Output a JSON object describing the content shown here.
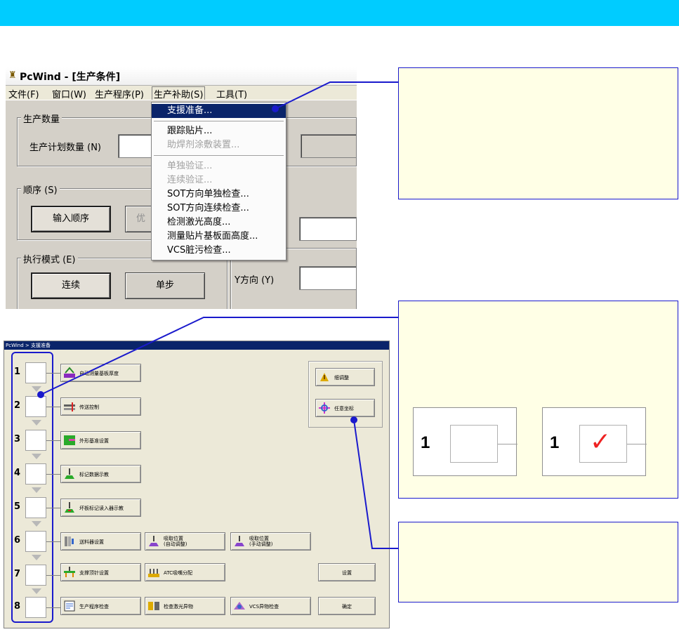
{
  "top_window": {
    "title": "PcWind - [生产条件]",
    "menubar": [
      "文件(F)",
      "窗口(W)",
      "生产程序(P)",
      "生产补助(S)",
      "工具(T)"
    ],
    "groups": {
      "quantity": {
        "label": "生产数量",
        "field_label": "生产计划数量 (N)"
      },
      "order": {
        "label": "顺序 (S)",
        "input_order_button": "输入顺序",
        "partial_button": "优"
      },
      "mode": {
        "label": "执行模式 (E)",
        "continuous_button": "连续",
        "single_step_button": "单步"
      },
      "y_direction_label": "Y方向 (Y)"
    },
    "dropdown": [
      {
        "label": "支援准备...",
        "state": "selected"
      },
      {
        "label": "跟踪贴片...",
        "state": "normal"
      },
      {
        "label": "助焊剂涂敷装置...",
        "state": "disabled"
      },
      {
        "label": "单独验证...",
        "state": "disabled"
      },
      {
        "label": "连续验证...",
        "state": "disabled"
      },
      {
        "label": "SOT方向单独检查...",
        "state": "normal"
      },
      {
        "label": "SOT方向连续检查...",
        "state": "normal"
      },
      {
        "label": "检测激光高度...",
        "state": "normal"
      },
      {
        "label": "测量贴片基板面高度...",
        "state": "normal"
      },
      {
        "label": "VCS脏污检查...",
        "state": "normal"
      }
    ]
  },
  "bottom_window": {
    "title": "PcWind > 支援准备",
    "steps": [
      "1",
      "2",
      "3",
      "4",
      "5",
      "6",
      "7",
      "8"
    ],
    "buttons": {
      "auto_board_thickness": "自动测量基板厚度",
      "transfer_control": "传送控制",
      "outline_reference": "外形基准设置",
      "mark_data_teaching": "标记数据示教",
      "ring_mark_teaching": "坏板标记读入器示教",
      "feeder_setting": "送料器设置",
      "nozzle_auto_sel": "吸取位置",
      "nozzle_auto_sub": "(自动调整)",
      "nozzle_manual_sel": "吸取位置",
      "nozzle_manual_sub": "(手动调整)",
      "support_pin_setting": "支撑顶针设置",
      "atc_nozzle_assign": "ATC吸嘴分配",
      "settings": "设置",
      "program_check": "生产程序检查",
      "laser_check": "检查激光异物",
      "vcs_check": "VCS异物检查",
      "confirm": "确定",
      "fine_adjust": "细调整",
      "arbitrary_coord": "任意坐标"
    }
  },
  "illustration": {
    "number": "1",
    "checkmark": "✓"
  },
  "colors": {
    "header_bar": "#00ccff",
    "callout_border": "#1a1acc",
    "pointer_line": "#1a1acc",
    "check_red": "#ee2222"
  }
}
